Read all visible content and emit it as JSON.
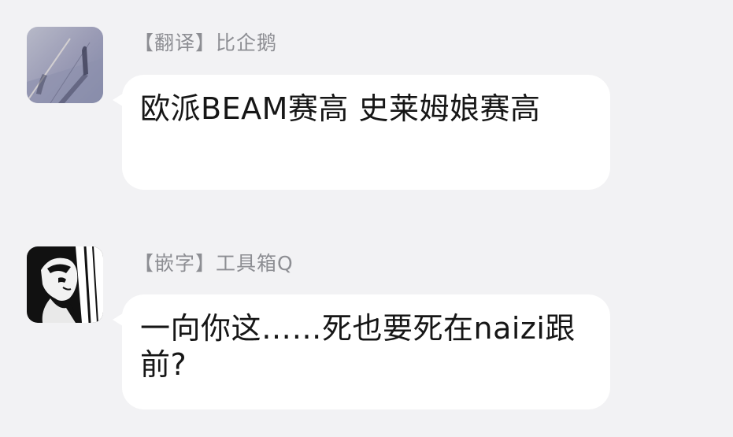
{
  "messages": [
    {
      "sender": "【翻译】比企鹅",
      "text": "欧派BEAM赛高  史莱姆娘赛高",
      "avatar_icon": "shadow-photo-avatar"
    },
    {
      "sender": "【嵌字】工具箱Q",
      "text": "一向你这……死也要死在naizi跟前?",
      "avatar_icon": "manga-portrait-avatar"
    }
  ],
  "colors": {
    "background": "#f2f2f4",
    "bubble": "#ffffff",
    "sender_text": "#8d8e93",
    "message_text": "#161616"
  }
}
